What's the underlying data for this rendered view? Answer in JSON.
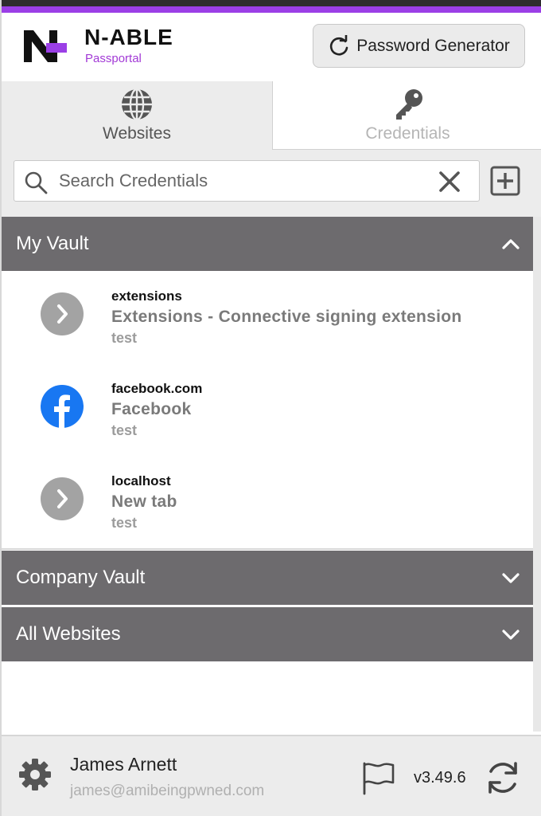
{
  "brand": {
    "name": "N-ABLE",
    "product": "Passportal",
    "accent_color": "#9b3fe6"
  },
  "header": {
    "password_generator_label": "Password Generator",
    "password_generator_icon": "refresh-icon"
  },
  "tabs": [
    {
      "label": "Websites",
      "icon": "globe-icon",
      "active": true
    },
    {
      "label": "Credentials",
      "icon": "key-icon",
      "active": false
    }
  ],
  "search": {
    "placeholder": "Search Credentials",
    "value": ""
  },
  "vaults": {
    "my_vault": {
      "title": "My Vault",
      "expanded": true,
      "items": [
        {
          "domain": "extensions",
          "title": "Extensions - Connective signing extension",
          "username": "test",
          "icon": "chevron-right-icon"
        },
        {
          "domain": "facebook.com",
          "title": "Facebook",
          "username": "test",
          "icon": "facebook-icon"
        },
        {
          "domain": "localhost",
          "title": "New tab",
          "username": "test",
          "icon": "chevron-right-icon"
        }
      ]
    },
    "company_vault": {
      "title": "Company Vault",
      "expanded": false
    },
    "all_websites": {
      "title": "All Websites",
      "expanded": false
    }
  },
  "footer": {
    "user_name": "James Arnett",
    "user_email": "james@amibeingpwned.com",
    "version": "v3.49.6"
  },
  "colors": {
    "section_header": "#6d6b6e",
    "facebook_blue": "#1877f2",
    "panel_bg": "#ececec"
  }
}
